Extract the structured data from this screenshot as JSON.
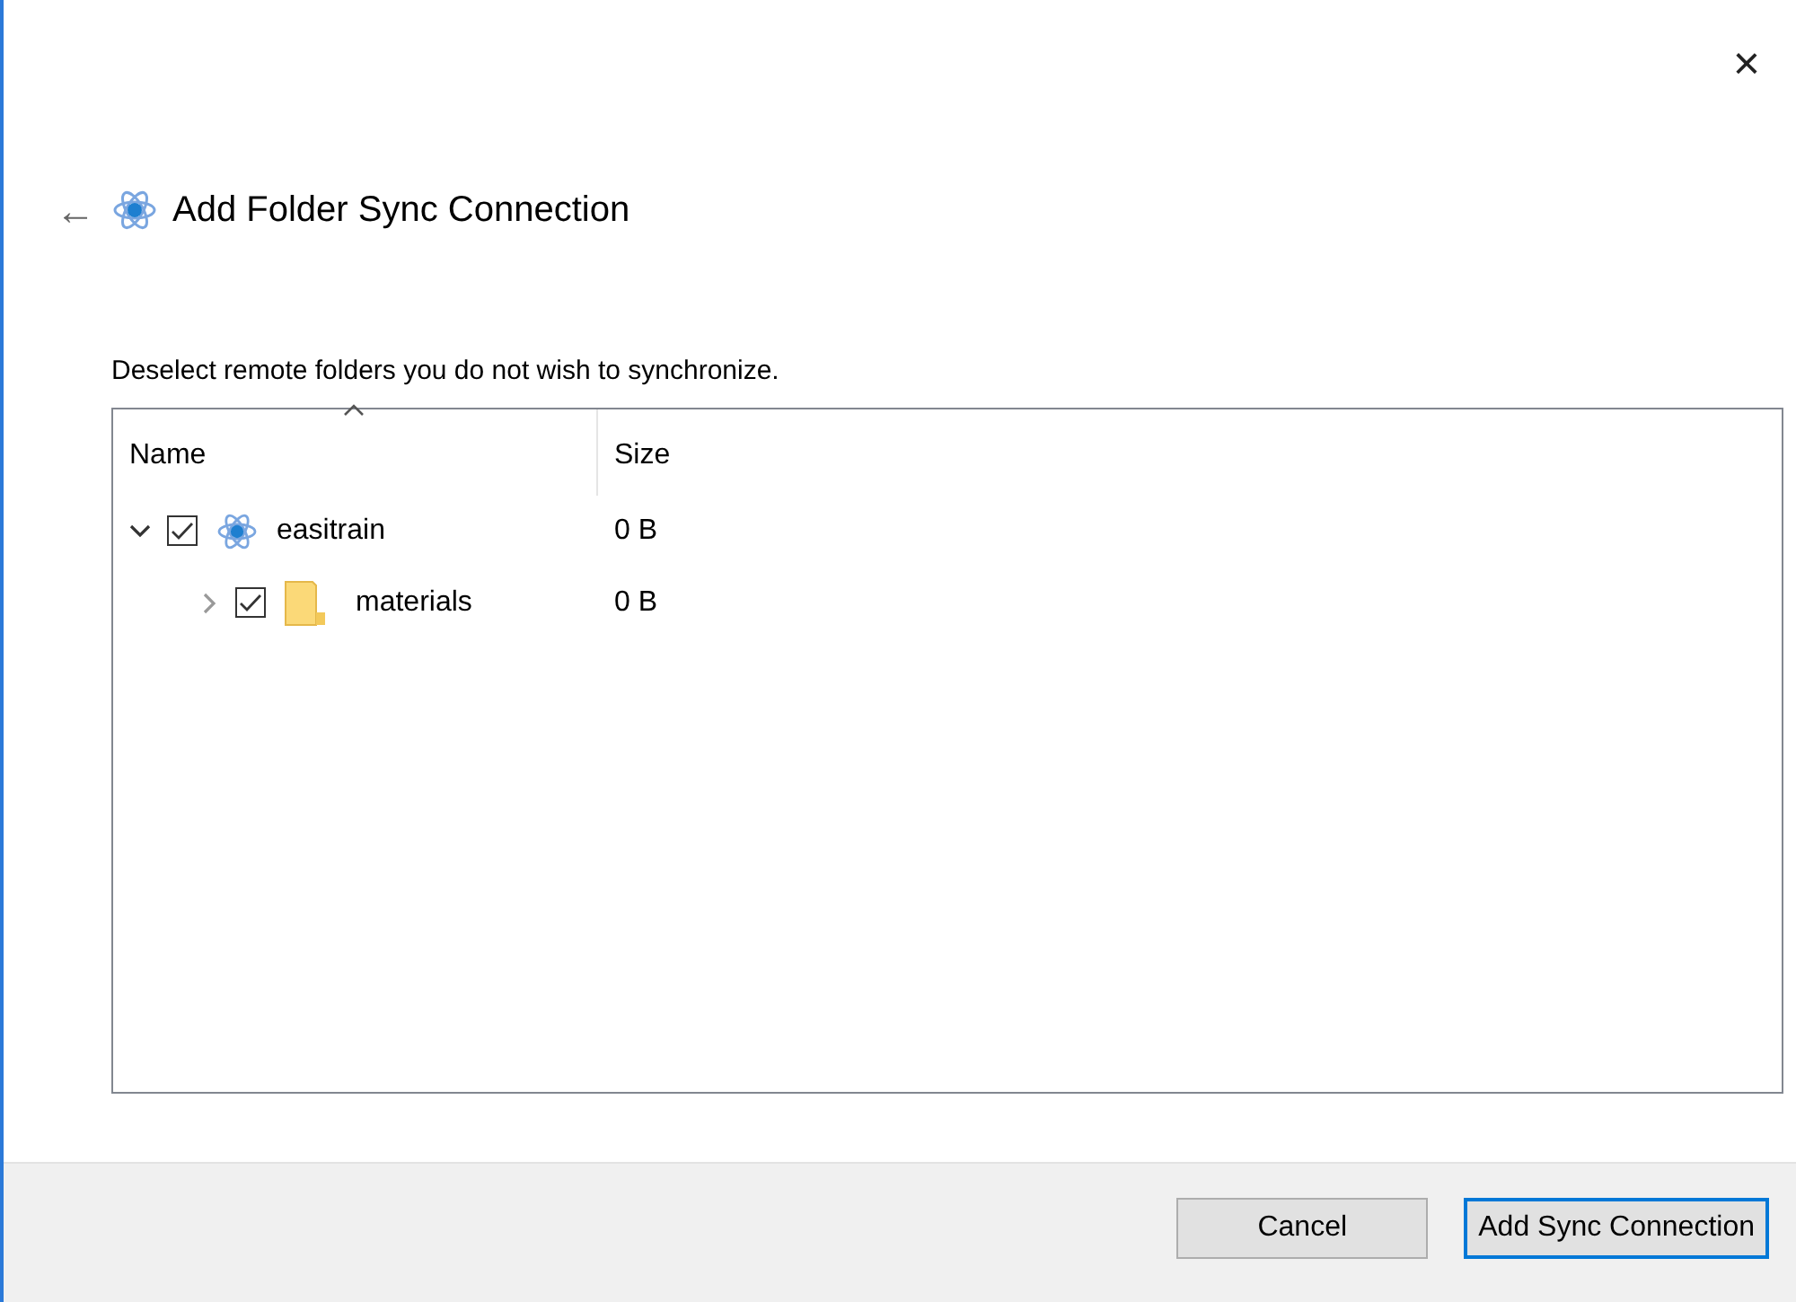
{
  "window": {
    "title": "Add Folder Sync Connection",
    "close": "×",
    "back": "←"
  },
  "instruction": "Deselect remote folders you do not wish to synchronize.",
  "tree": {
    "columns": [
      {
        "label": "Name",
        "sorted": true
      },
      {
        "label": "Size",
        "sorted": false
      }
    ],
    "items": [
      {
        "kind": "app",
        "name": "easitrain",
        "size": "0 B",
        "checked": true,
        "expanded": true,
        "children": [
          {
            "kind": "folder",
            "name": "materials",
            "size": "0 B",
            "checked": true,
            "expanded": false
          }
        ]
      }
    ]
  },
  "buttons": [
    {
      "label": "Cancel",
      "default": false
    },
    {
      "label": "Add Sync Connection",
      "default": true
    }
  ]
}
